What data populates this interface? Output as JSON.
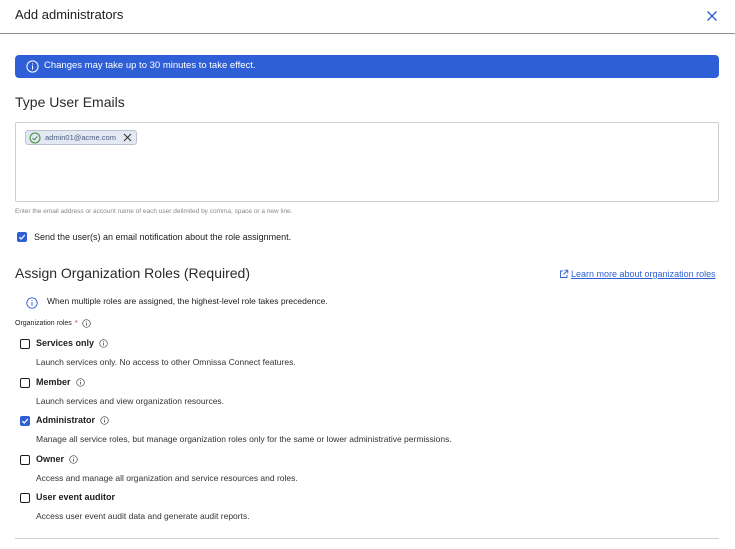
{
  "dialog": {
    "title": "Add administrators"
  },
  "banner": {
    "text": "Changes may take up to 30 minutes to take effect."
  },
  "emails": {
    "heading": "Type User Emails",
    "chips": [
      "admin01@acme.com"
    ],
    "hint": "Enter the email address or account name of each user delimited by comma, space or a new line."
  },
  "notify": {
    "label": "Send the user(s) an email notification about the role assignment.",
    "checked": true
  },
  "roles": {
    "heading": "Assign Organization Roles (Required)",
    "learn_more": "Learn more about organization roles",
    "note": "When multiple roles are assigned, the highest-level role takes precedence.",
    "field_label": "Organization roles",
    "required_mark": "*",
    "options": [
      {
        "name": "Services only",
        "desc": "Launch services only. No access to other Omnissa Connect features.",
        "checked": false,
        "info": true
      },
      {
        "name": "Member",
        "desc": "Launch services and view organization resources.",
        "checked": false,
        "info": true
      },
      {
        "name": "Administrator",
        "desc": "Manage all service roles, but manage organization roles only for the same or lower administrative permissions.",
        "checked": true,
        "info": true
      },
      {
        "name": "Owner",
        "desc": "Access and manage all organization and service resources and roles.",
        "checked": false,
        "info": true
      },
      {
        "name": "User event auditor",
        "desc": "Access user event audit data and generate audit reports.",
        "checked": false,
        "info": false
      }
    ]
  },
  "colors": {
    "accent": "#2f5fd6",
    "required": "#c62828"
  }
}
